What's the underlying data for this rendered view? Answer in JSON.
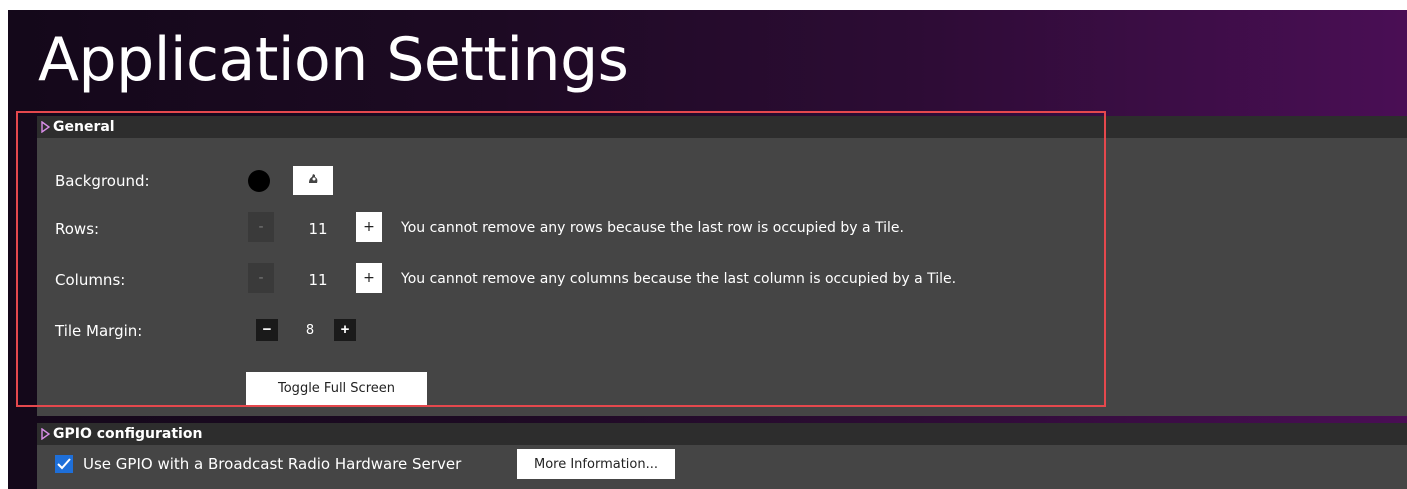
{
  "page": {
    "title": "Application Settings"
  },
  "general": {
    "header": "General",
    "background_label": "Background:",
    "background_color": "#000000",
    "rows_label": "Rows:",
    "rows_value": "11",
    "rows_minus": "-",
    "rows_plus": "+",
    "rows_message": "You cannot remove any rows because the last row is occupied by a Tile.",
    "columns_label": "Columns:",
    "columns_value": "11",
    "columns_minus": "-",
    "columns_plus": "+",
    "columns_message": "You cannot remove any columns because the last column is occupied by a Tile.",
    "margin_label": "Tile Margin:",
    "margin_value": "8",
    "margin_minus": "−",
    "margin_plus": "+",
    "toggle_label": "Toggle Full Screen"
  },
  "gpio": {
    "header": "GPIO configuration",
    "use_gpio_label": "Use GPIO with a Broadcast Radio Hardware Server",
    "use_gpio_checked": true,
    "more_info_label": "More Information..."
  },
  "colors": {
    "accent_triangle": "#d98ee8",
    "highlight_border": "#e5484d",
    "checkbox": "#1e6fd9"
  },
  "icons": {
    "section_expand": "triangle-right-icon",
    "color_picker": "color-picker-icon",
    "checkbox": "checkmark-icon"
  }
}
